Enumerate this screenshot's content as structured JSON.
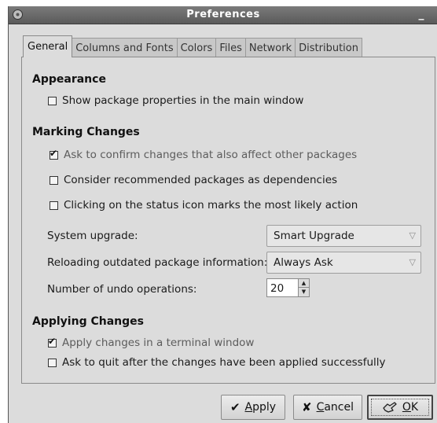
{
  "window": {
    "title": "Preferences",
    "minimize_label": "_"
  },
  "tabs": [
    {
      "label": "General",
      "active": true
    },
    {
      "label": "Columns and Fonts",
      "active": false
    },
    {
      "label": "Colors",
      "active": false
    },
    {
      "label": "Files",
      "active": false
    },
    {
      "label": "Network",
      "active": false
    },
    {
      "label": "Distribution",
      "active": false
    }
  ],
  "appearance": {
    "title": "Appearance",
    "show_props": {
      "label": "Show package properties in the main window",
      "checked": false
    }
  },
  "marking": {
    "title": "Marking Changes",
    "ask_confirm": {
      "label": "Ask to confirm changes that also affect other packages",
      "checked": true
    },
    "recommended": {
      "label": "Consider recommended packages as dependencies",
      "checked": false
    },
    "status_icon": {
      "label": "Clicking on the status icon marks the most likely action",
      "checked": false
    },
    "system_upgrade": {
      "label": "System upgrade:",
      "value": "Smart Upgrade"
    },
    "reloading": {
      "label": "Reloading outdated package information:",
      "value": "Always Ask"
    },
    "undo": {
      "label": "Number of undo operations:",
      "value": "20"
    }
  },
  "applying": {
    "title": "Applying Changes",
    "terminal": {
      "label": "Apply changes in a terminal window",
      "checked": true
    },
    "ask_quit": {
      "label": "Ask to quit after the changes have been applied successfully",
      "checked": false
    }
  },
  "buttons": {
    "apply": {
      "underline": "A",
      "rest": "pply",
      "icon": "checkmark-icon"
    },
    "cancel": {
      "underline": "C",
      "rest": "ancel",
      "icon": "x-icon"
    },
    "ok": {
      "underline": "O",
      "rest": "K",
      "icon": "ok-hand-icon"
    }
  },
  "icons": {
    "arrow": "▽",
    "spin_up": "▲",
    "spin_down": "▼",
    "check": "✔",
    "x": "✘"
  }
}
